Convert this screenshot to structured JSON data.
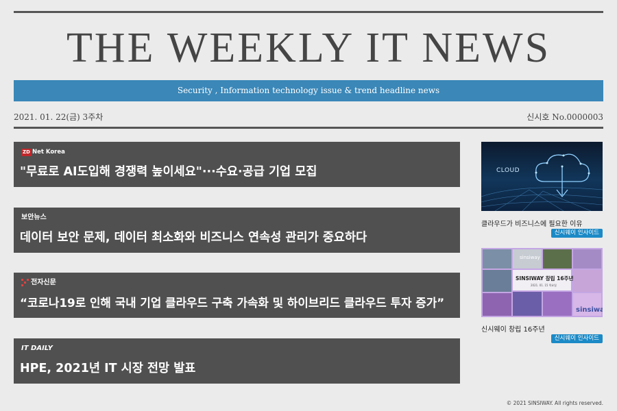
{
  "masthead": {
    "title": "THE WEEKLY IT NEWS",
    "tagline": "Security , Information technology issue & trend headline news",
    "date": "2021. 01. 22(금) 3주차",
    "issue": "신시호 No.0000003"
  },
  "news": [
    {
      "source": "Net Korea",
      "source_logo": "ZD",
      "headline": "\"무료로 AI도입해 경쟁력 높이세요\"···수요·공급 기업 모집"
    },
    {
      "source": "보안뉴스",
      "headline": "데이터 보안 문제, 데이터 최소화와 비즈니스 연속성 관리가 중요하다"
    },
    {
      "source": "전자신문",
      "headline": "“코로나19로 인해 국내 기업 클라우드 구축 가속화 및 하이브리드 클라우드 투자 증가”"
    },
    {
      "source": "IT DAILY",
      "headline": "HPE, 2021년 IT 시장 전망 발표"
    }
  ],
  "side": [
    {
      "image_text": "CLOUD",
      "caption": "클라우드가 비즈니스에 필요한 이유",
      "badge": "신시웨이 인사이드"
    },
    {
      "image_text": [
        "sinsiway",
        "SINSIWAY 창립 16주년",
        "2021. 01. 15 목요일",
        "sinsiway"
      ],
      "caption": "신시웨이 창립 16주년",
      "badge": "신시웨이 인사이드"
    }
  ],
  "footer": "© 2021 SINSIWAY. All rights reserved.",
  "colors": {
    "tagbar": "#3a87b8",
    "news_bg": "#505050",
    "badge": "#1c8ac6",
    "page_bg": "#ebebeb"
  }
}
